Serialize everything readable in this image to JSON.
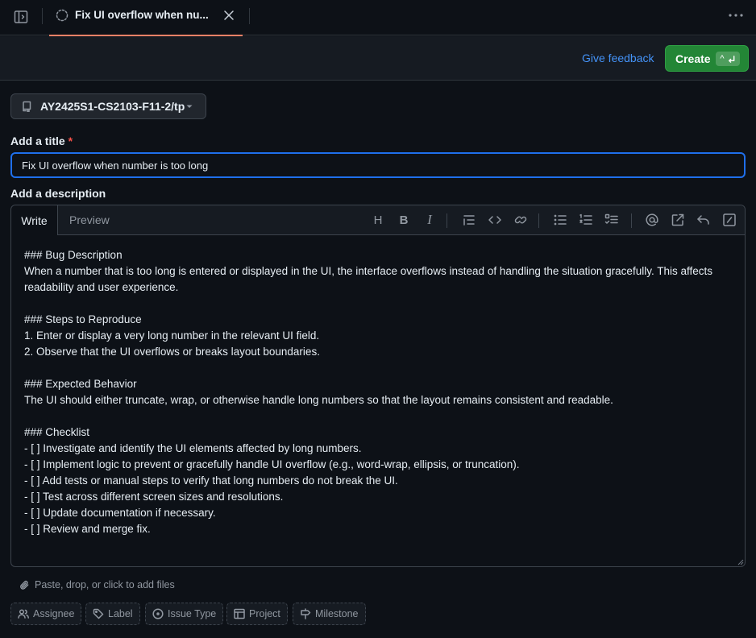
{
  "tab": {
    "title": "Fix UI overflow when nu..."
  },
  "header": {
    "feedback_label": "Give feedback",
    "create_label": "Create",
    "create_shortcut": "^",
    "accent_color": "#238636",
    "link_color": "#4493f8"
  },
  "repo": {
    "name": "AY2425S1-CS2103-F11-2/tp"
  },
  "title_field": {
    "label": "Add a title",
    "required_mark": "*",
    "value": "Fix UI overflow when number is too long"
  },
  "description": {
    "label": "Add a description",
    "tabs": {
      "write": "Write",
      "preview": "Preview"
    },
    "toolbar": {
      "heading": "H",
      "bold": "B",
      "italic": "I"
    },
    "lines": [
      "### Bug Description",
      "When a number that is too long is entered or displayed in the UI, the interface overflows instead of handling the situation gracefully. This affects readability and user experience.",
      "",
      "### Steps to Reproduce",
      "1. Enter or display a very long number in the relevant UI field.",
      "2. Observe that the UI overflows or breaks layout boundaries.",
      "",
      "### Expected Behavior",
      "The UI should either truncate, wrap, or otherwise handle long numbers so that the layout remains consistent and readable.",
      "",
      "### Checklist",
      "- [ ] Investigate and identify the UI elements affected by long numbers.",
      "- [ ] Implement logic to prevent or gracefully handle UI overflow (e.g., word-wrap, ellipsis, or truncation).",
      "- [ ] Add tests or manual steps to verify that long numbers do not break the UI.",
      "- [ ] Test across different screen sizes and resolutions.",
      "- [ ] Update documentation if necessary.",
      "- [ ] Review and merge fix."
    ]
  },
  "attach_hint": "Paste, drop, or click to add files",
  "metadata": {
    "assignee": "Assignee",
    "label": "Label",
    "issue_type": "Issue Type",
    "project": "Project",
    "milestone": "Milestone"
  }
}
